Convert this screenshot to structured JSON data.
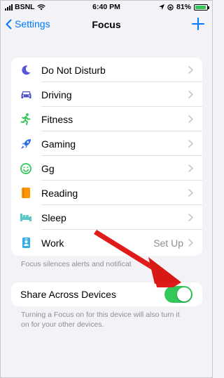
{
  "status_bar": {
    "carrier": "BSNL",
    "time": "6:40 PM",
    "battery": "81%"
  },
  "nav": {
    "back_label": "Settings",
    "title": "Focus"
  },
  "focus_list": {
    "items": [
      {
        "label": "Do Not Disturb",
        "icon": "moon-icon",
        "color": "#5856d6",
        "value": ""
      },
      {
        "label": "Driving",
        "icon": "car-icon",
        "color": "#4b52c6",
        "value": ""
      },
      {
        "label": "Fitness",
        "icon": "running-figure-icon",
        "color": "#34c759",
        "value": ""
      },
      {
        "label": "Gaming",
        "icon": "rocket-icon",
        "color": "#2f6fe0",
        "value": ""
      },
      {
        "label": "Gg",
        "icon": "smiley-icon",
        "color": "#34c759",
        "value": ""
      },
      {
        "label": "Reading",
        "icon": "book-icon",
        "color": "#ff9500",
        "value": ""
      },
      {
        "label": "Sleep",
        "icon": "bed-icon",
        "color": "#5ac8c8",
        "value": ""
      },
      {
        "label": "Work",
        "icon": "badge-icon",
        "color": "#32ade6",
        "value": "Set Up"
      }
    ],
    "footnote": "Focus silences alerts and notificat"
  },
  "share": {
    "label": "Share Across Devices",
    "enabled": true,
    "footnote_line1": "Turning a Focus on for this device will also turn it",
    "footnote_line2": "on for your other devices."
  },
  "colors": {
    "accent": "#007aff",
    "toggle_on": "#34c759",
    "arrow": "#e01b1b",
    "background": "#f2f2f7"
  }
}
